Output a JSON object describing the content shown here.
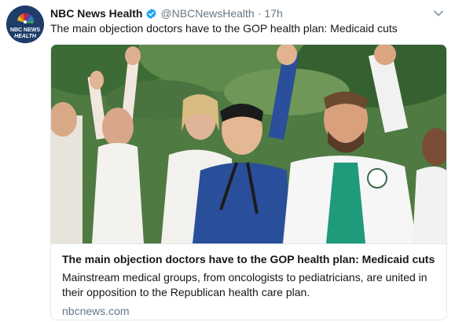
{
  "tweet": {
    "author": {
      "avatar_icon": "nbc-news-health-logo",
      "avatar_text_line1": "NBC NEWS",
      "avatar_text_line2": "HEALTH",
      "name": "NBC News Health",
      "verified_icon": "verified-badge-icon",
      "handle": "@NBCNewsHealth"
    },
    "separator": "·",
    "time": "17h",
    "menu_icon": "chevron-down-icon",
    "text": "The main objection doctors have to the GOP health plan: Medicaid cuts",
    "card": {
      "image_description_icon": "doctors-rally-photo",
      "title": "The main objection doctors have to the GOP health plan: Medicaid cuts",
      "description": "Mainstream medical groups, from oncologists to pediatricians, are united in their opposition to the Republican health care plan.",
      "domain": "nbcnews.com"
    }
  },
  "colors": {
    "verified_blue": "#1da1f2",
    "secondary_text": "#657786",
    "border": "#e1e8ed",
    "scrub_blue": "#2a4f9a",
    "scrub_teal": "#1f9a7a",
    "foliage_green": "#3d6b35"
  }
}
